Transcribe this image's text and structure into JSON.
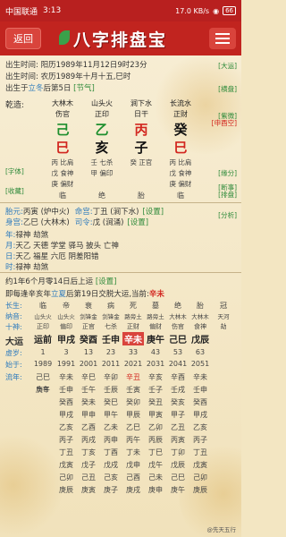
{
  "status": {
    "carrier": "中国联通",
    "time": "3:13",
    "net": "17.0 KB/s",
    "battery": "66"
  },
  "header": {
    "back": "返回",
    "brand": "八字排盘宝"
  },
  "birth": {
    "lines": [
      {
        "label": "出生时间: ",
        "value": "阳历1989年11月12日9时23分",
        "tag": ""
      },
      {
        "label": "出生时间: ",
        "value": "农历1989年十月十五,巳时",
        "tag": ""
      },
      {
        "label": "出生于",
        "value": "立冬",
        "suffix": "后第5日",
        "tag": "[节气]"
      }
    ],
    "right_tags": [
      "[大运]",
      "[横盘]"
    ]
  },
  "pillars": {
    "row_label": "乾造:",
    "nayin": [
      "大林木",
      "山头火",
      "涧下水",
      "长流水"
    ],
    "shishen": [
      "伤官",
      "正印",
      "日干",
      "正财"
    ],
    "gan": [
      "己",
      "乙",
      "丙",
      "癸"
    ],
    "zhi": [
      "巳",
      "亥",
      "子",
      "巳"
    ],
    "kongwang": "[申酉空]",
    "cang1": [
      "丙 比肩",
      "壬 七杀",
      "癸 正官",
      "丙 比肩"
    ],
    "cang2": [
      "戊 食神",
      "甲 偏印",
      "",
      "戊 食神"
    ],
    "cang3": [
      "庚 偏财",
      "",
      "",
      "庚 偏财"
    ],
    "changsheng": [
      "临",
      "绝",
      "胎",
      "临"
    ],
    "side_tags": [
      "[紫微]",
      "[字体]",
      "[收藏]",
      "[缘分]",
      "[断事]",
      "[排盘]",
      "[分析]"
    ]
  },
  "info": [
    {
      "label": "胎元:",
      "value": "丙寅 (炉中火)",
      "label2": "命宫:",
      "value2": "丁丑 (涧下水)",
      "tag": "[设置]"
    },
    {
      "label": "身宫:",
      "value": "乙巳 (大林木)",
      "label2": "司令:",
      "value2": "戊 (涧涌)",
      "tag": "[设置]"
    },
    {
      "label": "年:",
      "value": "禄神 劫煞",
      "label2": "",
      "value2": "",
      "tag": ""
    },
    {
      "label": "月:",
      "value": "天乙 天德 学堂 驿马 披头 亡神",
      "label2": "",
      "value2": "",
      "tag": ""
    },
    {
      "label": "日:",
      "value": "天乙 福星 六厄 阴差阳错",
      "label2": "",
      "value2": "",
      "tag": ""
    },
    {
      "label": "时:",
      "value": "禄神 劫煞",
      "label2": "",
      "value2": "",
      "tag": ""
    }
  ],
  "qiyun": {
    "line1": "约1年6个月零14日后上运",
    "tag1": "[设置]",
    "line2_prefix": "即每逢辛亥年",
    "line2_mid": "立夏",
    "line2_suffix": "后第19日交脱大运,当前:",
    "current": "辛未"
  },
  "dayun": {
    "labels": [
      "长生:",
      "纳音:",
      "十神:",
      "大运",
      "虚岁:",
      "始于:",
      "流年:"
    ],
    "changsheng": [
      "临",
      "帝",
      "衰",
      "病",
      "死",
      "墓",
      "绝",
      "胎",
      "冠"
    ],
    "nayin": [
      "山头火",
      "山头火",
      "剑锋金",
      "剑锋金",
      "路旁土",
      "路旁土",
      "大林木",
      "大林木",
      "天河"
    ],
    "shishen": [
      "正印",
      "偏印",
      "正官",
      "七杀",
      "正财",
      "偏财",
      "伤官",
      "食神",
      "劫"
    ],
    "yun": [
      "运前",
      "甲戌",
      "癸酉",
      "壬申",
      "辛未",
      "庚午",
      "己巳",
      "戊辰"
    ],
    "xusui": [
      "1",
      "3",
      "13",
      "23",
      "33",
      "43",
      "53",
      "63"
    ],
    "start": [
      "1989",
      "1991",
      "2001",
      "2011",
      "2021",
      "2031",
      "2041",
      "2051"
    ],
    "liunian": [
      [
        "己巳",
        "辛未",
        "辛巳",
        "辛卯",
        "辛丑",
        "辛亥",
        "辛酉",
        "辛未"
      ],
      [
        "庚午",
        "壬申",
        "壬午",
        "壬辰",
        "壬寅",
        "壬子",
        "壬戌",
        "壬申"
      ],
      [
        "",
        "癸酉",
        "癸未",
        "癸巳",
        "癸卯",
        "癸丑",
        "癸亥",
        "癸酉"
      ],
      [
        "",
        "甲戌",
        "甲申",
        "甲午",
        "甲辰",
        "甲寅",
        "甲子",
        "甲戌"
      ],
      [
        "",
        "乙亥",
        "乙酉",
        "乙未",
        "乙巳",
        "乙卯",
        "乙丑",
        "乙亥"
      ],
      [
        "",
        "丙子",
        "丙戌",
        "丙申",
        "丙午",
        "丙辰",
        "丙寅",
        "丙子"
      ],
      [
        "",
        "丁丑",
        "丁亥",
        "丁酉",
        "丁未",
        "丁巳",
        "丁卯",
        "丁丑"
      ],
      [
        "",
        "戊寅",
        "戊子",
        "戊戌",
        "戊申",
        "戊午",
        "戊辰",
        "戊寅"
      ],
      [
        "",
        "己卯",
        "己丑",
        "己亥",
        "己酉",
        "己未",
        "己巳",
        "己卯"
      ],
      [
        "",
        "庚辰",
        "庚寅",
        "庚子",
        "庚戌",
        "庚申",
        "庚午",
        "庚辰"
      ]
    ],
    "liunian_shishen": [
      "伤官",
      "",
      "",
      "",
      "",
      "",
      "",
      ""
    ]
  },
  "watermark": "@先天五行"
}
